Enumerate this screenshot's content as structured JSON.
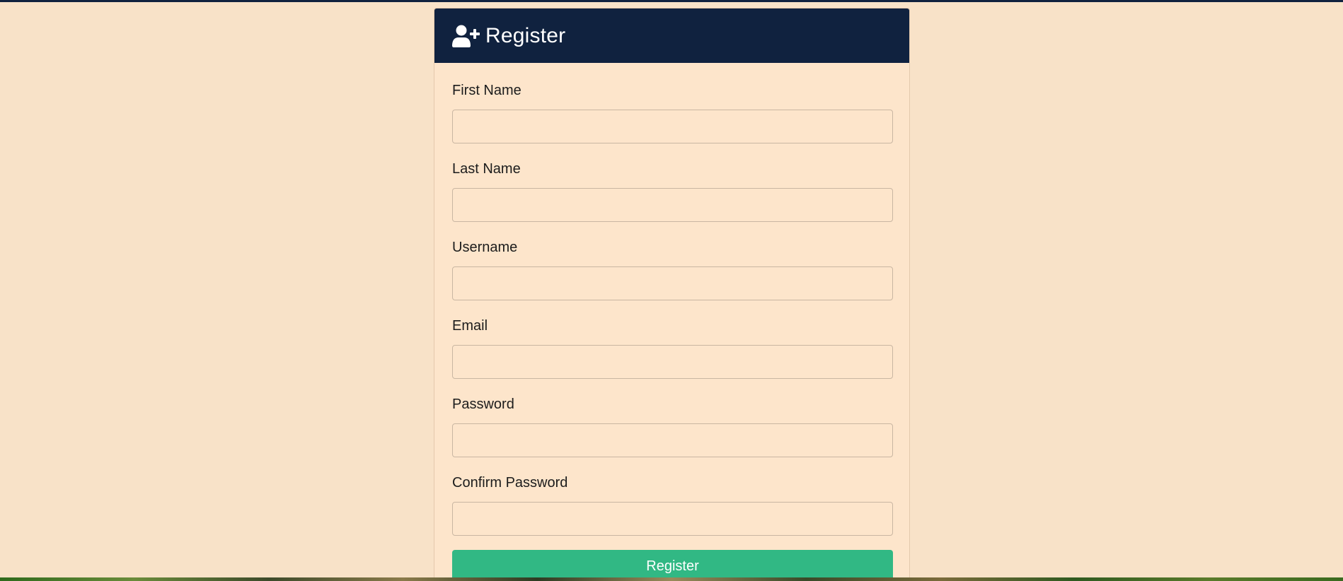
{
  "colors": {
    "page_background": "#f8e2c8",
    "header_background": "#10223f",
    "card_background": "#fde5cb",
    "button_background": "#31b884"
  },
  "header": {
    "icon": "user-plus-icon",
    "title": "Register"
  },
  "form": {
    "fields": [
      {
        "label": "First Name",
        "value": "",
        "placeholder": ""
      },
      {
        "label": "Last Name",
        "value": "",
        "placeholder": ""
      },
      {
        "label": "Username",
        "value": "",
        "placeholder": ""
      },
      {
        "label": "Email",
        "value": "",
        "placeholder": ""
      },
      {
        "label": "Password",
        "value": "",
        "placeholder": ""
      },
      {
        "label": "Confirm Password",
        "value": "",
        "placeholder": ""
      }
    ],
    "submit_label": "Register"
  }
}
